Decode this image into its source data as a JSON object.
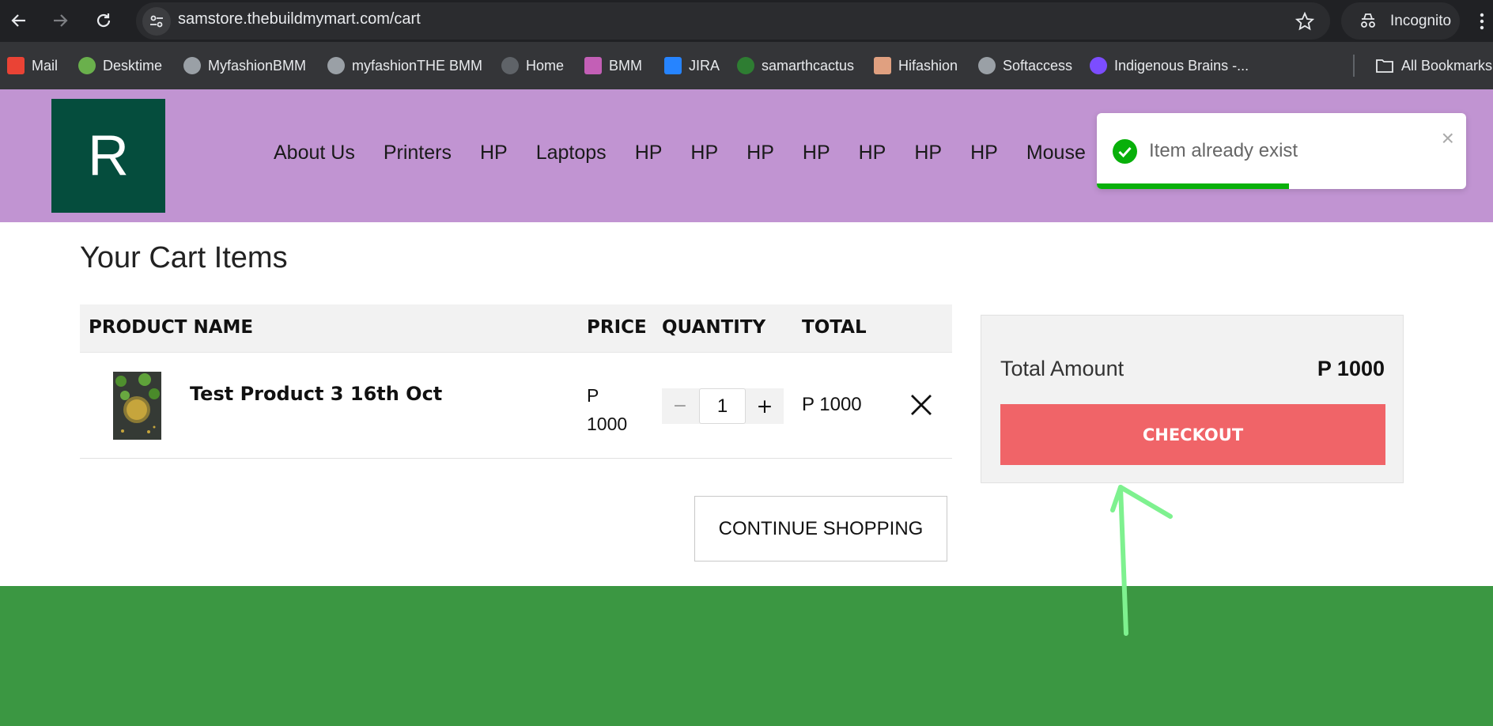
{
  "browser": {
    "url": "samstore.thebuildmymart.com/cart",
    "profile_label": "Incognito",
    "bookmarks": [
      {
        "label": "Mail",
        "icon": "gmail-icon",
        "color": "#ea4335"
      },
      {
        "label": "Desktime",
        "icon": "desktime-icon",
        "color": "#6ab04c"
      },
      {
        "label": "MyfashionBMM",
        "icon": "globe-icon",
        "color": "#9aa0a6"
      },
      {
        "label": "myfashionTHE BMM",
        "icon": "globe-icon",
        "color": "#9aa0a6"
      },
      {
        "label": "Home",
        "icon": "globe-icon",
        "color": "#5f6368"
      },
      {
        "label": "BMM",
        "icon": "bmm-icon",
        "color": "#c35fb6"
      },
      {
        "label": "JIRA",
        "icon": "jira-icon",
        "color": "#2684ff"
      },
      {
        "label": "samarthcactus",
        "icon": "cactus-icon",
        "color": "#2e7d32"
      },
      {
        "label": "Hifashion",
        "icon": "hifashion-icon",
        "color": "#e0a080"
      },
      {
        "label": "Softaccess",
        "icon": "globe-icon",
        "color": "#9aa0a6"
      },
      {
        "label": "Indigenous Brains -...",
        "icon": "indigenous-icon",
        "color": "#7c4dff"
      }
    ],
    "all_bookmarks_label": "All Bookmarks"
  },
  "header": {
    "logo_letter": "R",
    "nav": [
      "About Us",
      "Printers",
      "HP",
      "Laptops",
      "HP",
      "HP",
      "HP",
      "HP",
      "HP",
      "HP",
      "HP",
      "Mouse"
    ]
  },
  "toast": {
    "message": "Item already exist",
    "progress": 0.52,
    "close_symbol": "×"
  },
  "cart": {
    "title": "Your Cart Items",
    "columns": {
      "product": "PRODUCT NAME",
      "price": "PRICE",
      "quantity": "QUANTITY",
      "total": "TOTAL"
    },
    "items": [
      {
        "name": "Test Product 3 16th Oct",
        "price_currency": "P",
        "price_amount": "1000",
        "quantity": "1",
        "total": "P 1000"
      }
    ],
    "continue_label": "CONTINUE SHOPPING"
  },
  "summary": {
    "total_label": "Total Amount",
    "total_value": "P 1000",
    "checkout_label": "CHECKOUT"
  },
  "colors": {
    "header_bg": "#c194d2",
    "logo_bg": "#054d3d",
    "checkout_bg": "#f06468",
    "footer_bg": "#3b9742",
    "toast_success": "#08b00a",
    "annotation": "#7ef18f"
  }
}
